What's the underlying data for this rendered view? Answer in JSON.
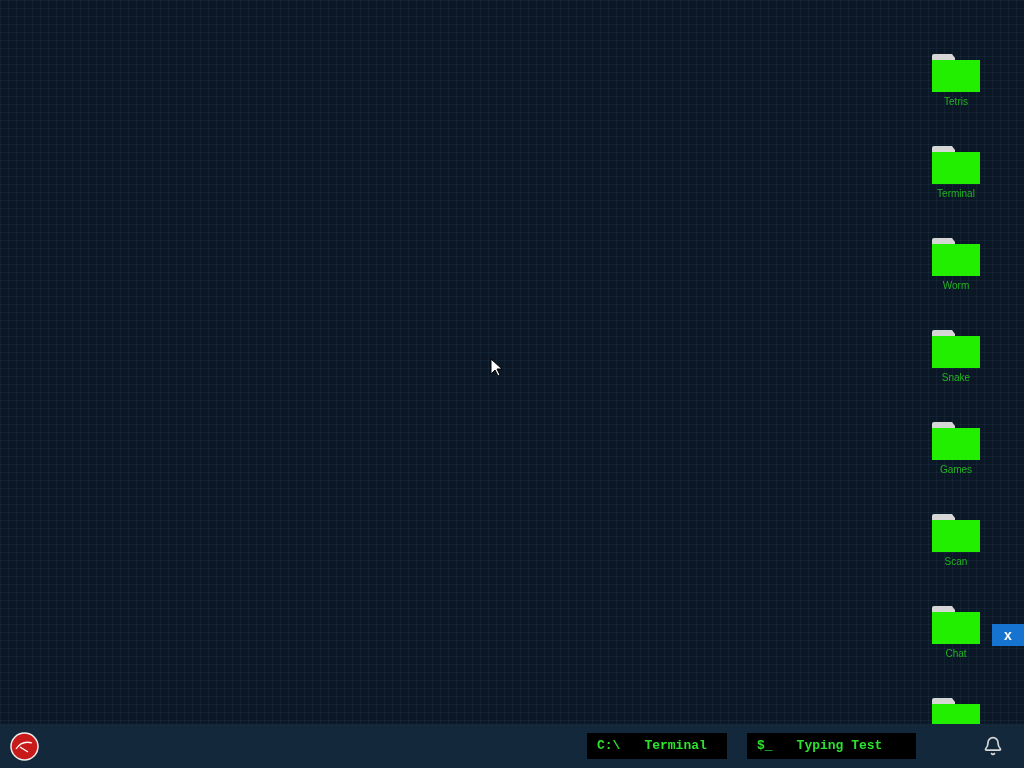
{
  "desktop_icons": [
    {
      "kind": "folder",
      "label": "Tetris"
    },
    {
      "kind": "folder",
      "label": "Terminal"
    },
    {
      "kind": "folder",
      "label": "Worm"
    },
    {
      "kind": "folder",
      "label": "Snake"
    },
    {
      "kind": "folder",
      "label": "Games"
    },
    {
      "kind": "folder",
      "label": "Scan"
    },
    {
      "kind": "folder",
      "label": "Chat"
    },
    {
      "kind": "folder"
    }
  ],
  "side_close": "x",
  "taskbar": {
    "windows": [
      {
        "prompt": "C:\\",
        "title": "Terminal"
      },
      {
        "prompt": "$_",
        "title": "Typing Test"
      }
    ]
  }
}
